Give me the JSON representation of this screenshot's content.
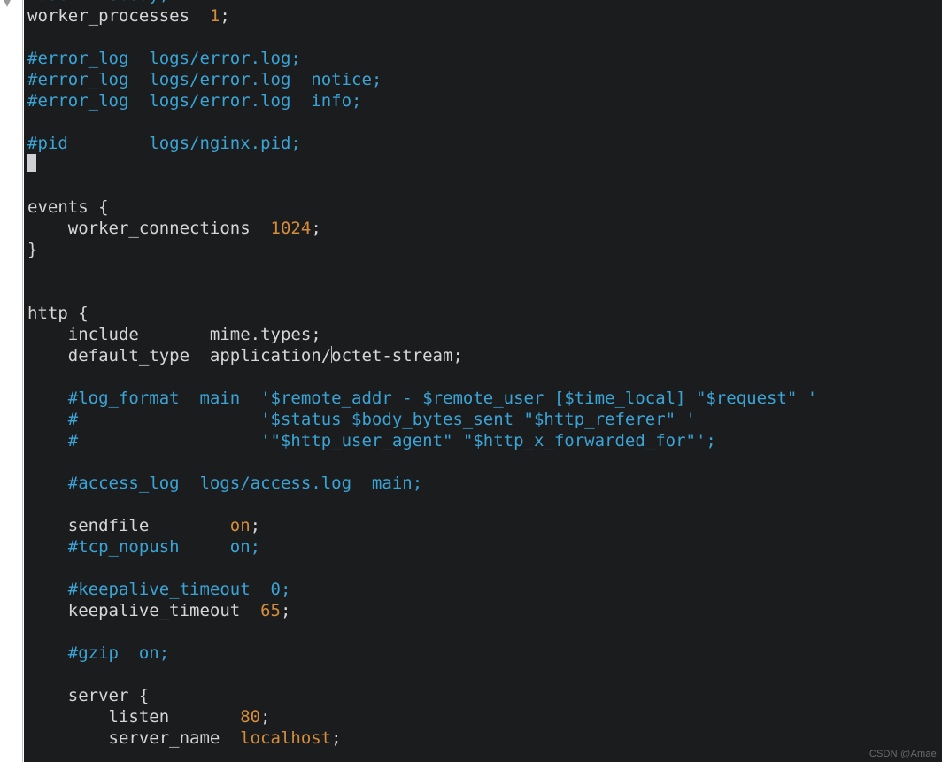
{
  "watermark": "CSDN @Amae",
  "lines": [
    {
      "segments": [
        {
          "cls": "c-comment",
          "text": "#user  nobody;"
        }
      ]
    },
    {
      "segments": [
        {
          "cls": "c-plain",
          "text": "worker_processes  "
        },
        {
          "cls": "c-value",
          "text": "1"
        },
        {
          "cls": "c-plain",
          "text": ";"
        }
      ]
    },
    {
      "segments": []
    },
    {
      "segments": [
        {
          "cls": "c-comment",
          "text": "#error_log  logs/error.log;"
        }
      ]
    },
    {
      "segments": [
        {
          "cls": "c-comment",
          "text": "#error_log  logs/error.log  notice;"
        }
      ]
    },
    {
      "segments": [
        {
          "cls": "c-comment",
          "text": "#error_log  logs/error.log  info;"
        }
      ]
    },
    {
      "segments": []
    },
    {
      "segments": [
        {
          "cls": "c-comment",
          "text": "#pid        logs/nginx.pid;"
        }
      ]
    },
    {
      "caret": true,
      "segments": []
    },
    {
      "segments": []
    },
    {
      "segments": [
        {
          "cls": "c-plain",
          "text": "events {"
        }
      ]
    },
    {
      "segments": [
        {
          "cls": "c-plain",
          "text": "    worker_connections  "
        },
        {
          "cls": "c-value",
          "text": "1024"
        },
        {
          "cls": "c-plain",
          "text": ";"
        }
      ]
    },
    {
      "segments": [
        {
          "cls": "c-plain",
          "text": "}"
        }
      ]
    },
    {
      "segments": []
    },
    {
      "segments": []
    },
    {
      "segments": [
        {
          "cls": "c-plain",
          "text": "http {"
        }
      ]
    },
    {
      "segments": [
        {
          "cls": "c-plain",
          "text": "    include       mime.types;"
        }
      ]
    },
    {
      "segments": [
        {
          "cls": "c-plain",
          "text": "    default_type  application/"
        },
        {
          "cls": "text-cursor-marker",
          "text": ""
        },
        {
          "cls": "c-plain",
          "text": "octet-stream;"
        }
      ]
    },
    {
      "segments": []
    },
    {
      "segments": [
        {
          "cls": "c-plain",
          "text": "    "
        },
        {
          "cls": "c-comment",
          "text": "#log_format  main  '$remote_addr - $remote_user [$time_local] \"$request\" '"
        }
      ]
    },
    {
      "segments": [
        {
          "cls": "c-plain",
          "text": "    "
        },
        {
          "cls": "c-comment",
          "text": "#                  '$status $body_bytes_sent \"$http_referer\" '"
        }
      ]
    },
    {
      "segments": [
        {
          "cls": "c-plain",
          "text": "    "
        },
        {
          "cls": "c-comment",
          "text": "#                  '\"$http_user_agent\" \"$http_x_forwarded_for\"';"
        }
      ]
    },
    {
      "segments": []
    },
    {
      "segments": [
        {
          "cls": "c-plain",
          "text": "    "
        },
        {
          "cls": "c-comment",
          "text": "#access_log  logs/access.log  main;"
        }
      ]
    },
    {
      "segments": []
    },
    {
      "segments": [
        {
          "cls": "c-plain",
          "text": "    sendfile        "
        },
        {
          "cls": "c-value",
          "text": "on"
        },
        {
          "cls": "c-plain",
          "text": ";"
        }
      ]
    },
    {
      "segments": [
        {
          "cls": "c-plain",
          "text": "    "
        },
        {
          "cls": "c-comment",
          "text": "#tcp_nopush     on;"
        }
      ]
    },
    {
      "segments": []
    },
    {
      "segments": [
        {
          "cls": "c-plain",
          "text": "    "
        },
        {
          "cls": "c-comment",
          "text": "#keepalive_timeout  0;"
        }
      ]
    },
    {
      "segments": [
        {
          "cls": "c-plain",
          "text": "    keepalive_timeout  "
        },
        {
          "cls": "c-value",
          "text": "65"
        },
        {
          "cls": "c-plain",
          "text": ";"
        }
      ]
    },
    {
      "segments": []
    },
    {
      "segments": [
        {
          "cls": "c-plain",
          "text": "    "
        },
        {
          "cls": "c-comment",
          "text": "#gzip  on;"
        }
      ]
    },
    {
      "segments": []
    },
    {
      "segments": [
        {
          "cls": "c-plain",
          "text": "    server {"
        }
      ]
    },
    {
      "segments": [
        {
          "cls": "c-plain",
          "text": "        listen       "
        },
        {
          "cls": "c-value",
          "text": "80"
        },
        {
          "cls": "c-plain",
          "text": ";"
        }
      ]
    },
    {
      "segments": [
        {
          "cls": "c-plain",
          "text": "        server_name  "
        },
        {
          "cls": "c-value",
          "text": "localhost"
        },
        {
          "cls": "c-plain",
          "text": ";"
        }
      ]
    }
  ]
}
